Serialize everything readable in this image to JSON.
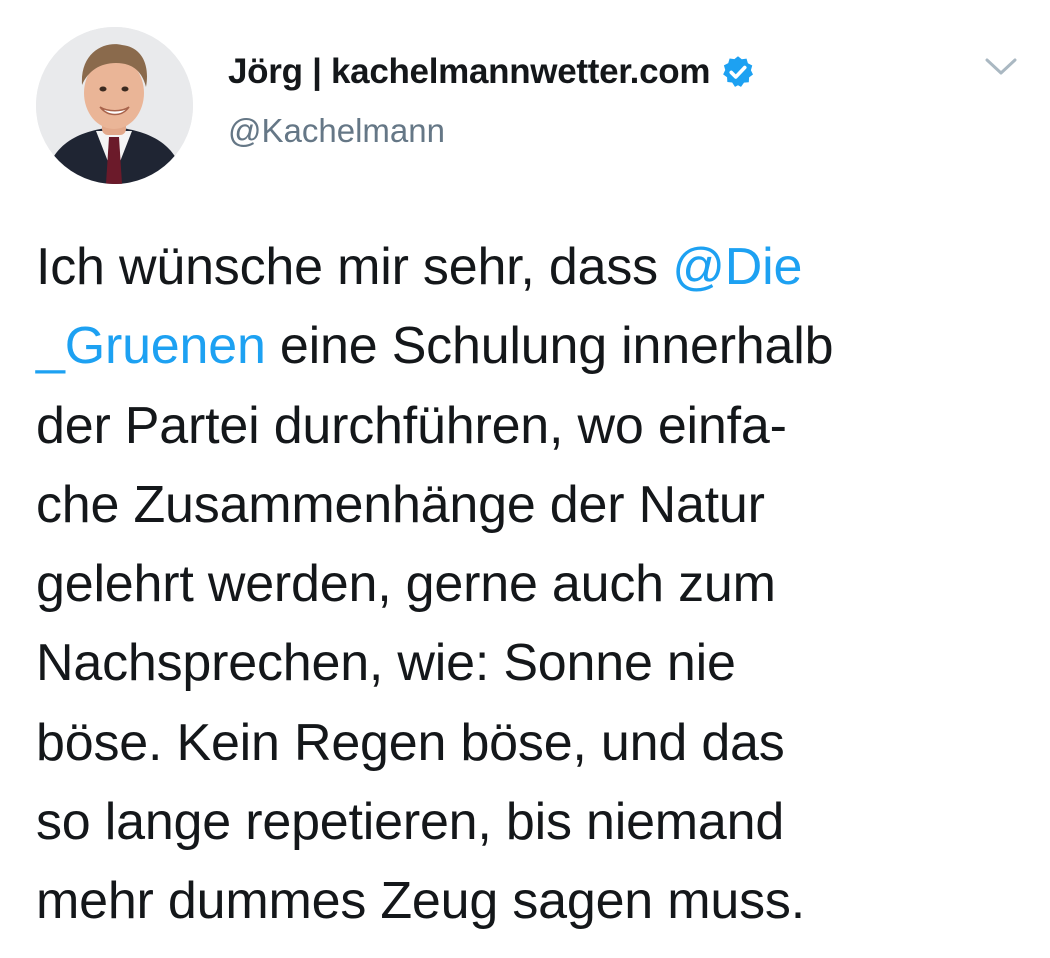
{
  "author": {
    "display_name": "Jörg | kachelmannwetter.com",
    "handle": "@Kachelmann",
    "avatar_icon": "person-portrait-avatar",
    "verified_icon": "verified-badge-icon",
    "verified_color": "#1da1f2"
  },
  "menu": {
    "icon": "chevron-down-icon",
    "color": "#aab8c2"
  },
  "tweet": {
    "mention_color": "#1da1f2",
    "text_color": "#14171a",
    "lines": [
      {
        "before": "Ich wünsche mir sehr, dass ",
        "mention": "@Die",
        "after": ""
      },
      {
        "before": "",
        "mention": "_Gruenen",
        "after": " eine Schulung innerhalb"
      },
      {
        "before": "der Partei durchführen, wo einfa-",
        "mention": "",
        "after": ""
      },
      {
        "before": "che Zusammenhänge der Natur",
        "mention": "",
        "after": ""
      },
      {
        "before": "gelehrt werden, gerne auch zum",
        "mention": "",
        "after": ""
      },
      {
        "before": "Nachsprechen, wie: Sonne nie",
        "mention": "",
        "after": ""
      },
      {
        "before": "böse. Kein Regen böse, und das",
        "mention": "",
        "after": ""
      },
      {
        "before": "so lange repetieren, bis niemand",
        "mention": "",
        "after": ""
      },
      {
        "before": "mehr dummes Zeug sagen muss.",
        "mention": "",
        "after": ""
      }
    ]
  }
}
